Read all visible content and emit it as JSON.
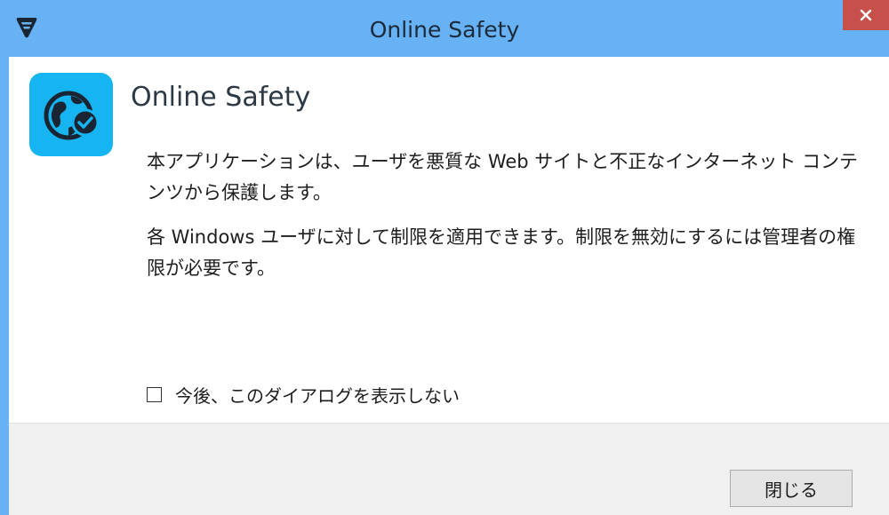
{
  "window": {
    "title": "Online Safety",
    "titlebar_color": "#67b2f4",
    "close_button_color": "#c7504b",
    "close_icon": "close-icon",
    "title_logo_icon": "f-secure-logo-icon"
  },
  "content": {
    "app_icon": "globe-check-icon",
    "app_icon_color": "#16b4f0",
    "heading": "Online Safety",
    "paragraph1": "本アプリケーションは、ユーザを悪質な Web サイトと不正なインターネット コンテンツから保護します。",
    "paragraph2": "各 Windows ユーザに対して制限を適用できます。制限を無効にするには管理者の権限が必要です。",
    "checkbox": {
      "label": "今後、このダイアログを表示しない",
      "checked": false
    }
  },
  "footer": {
    "close_button_label": "閉じる"
  }
}
